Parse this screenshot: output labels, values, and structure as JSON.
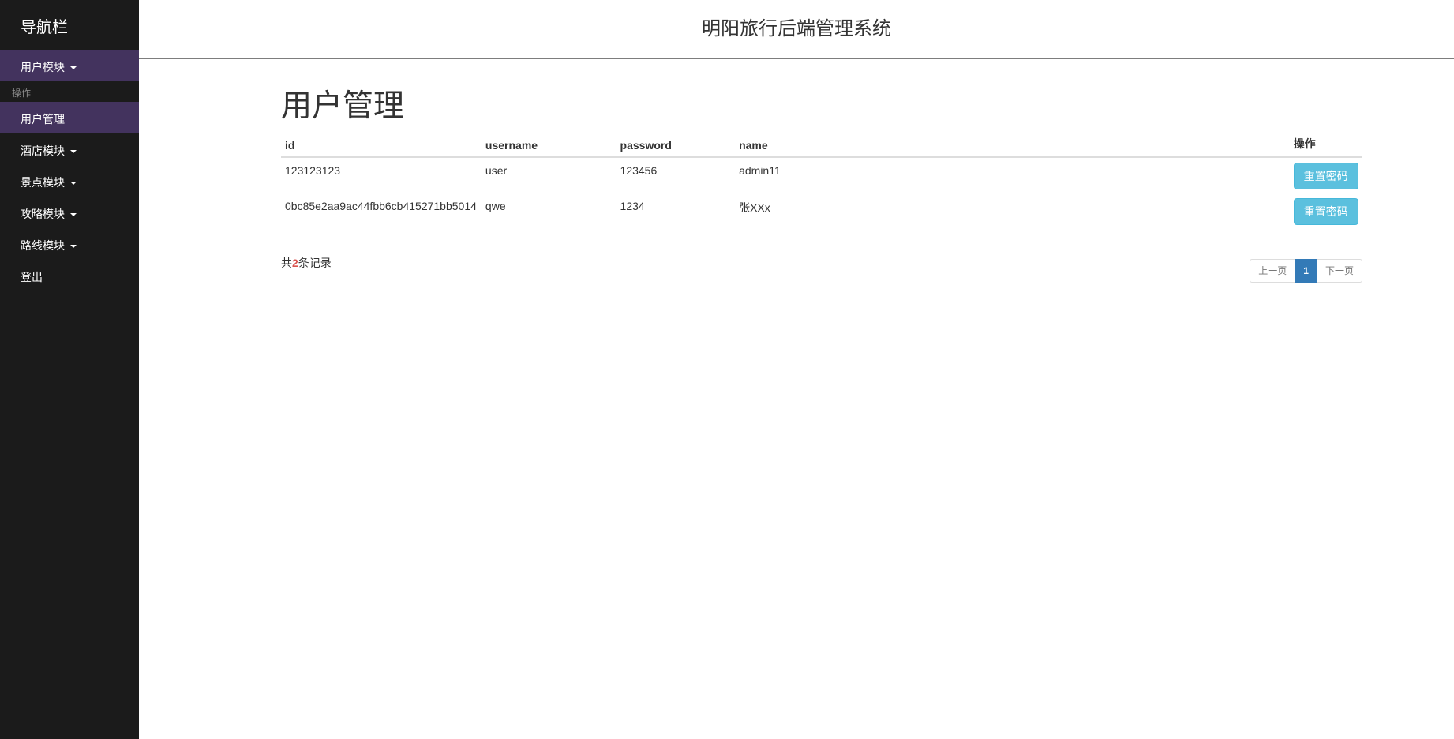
{
  "sidebar": {
    "brand": "导航栏",
    "user_module": "用户模块",
    "section_header": "操作",
    "user_management": "用户管理",
    "hotel_module": "酒店模块",
    "attraction_module": "景点模块",
    "guide_module": "攻略模块",
    "route_module": "路线模块",
    "logout": "登出"
  },
  "header": {
    "title": "明阳旅行后端管理系统"
  },
  "main": {
    "page_title": "用户管理",
    "table": {
      "columns": [
        "id",
        "username",
        "password",
        "name",
        "操作"
      ],
      "rows": [
        {
          "id": "123123123",
          "username": "user",
          "password": "123456",
          "name": "admin11",
          "action": "重置密码"
        },
        {
          "id": "0bc85e2aa9ac44fbb6cb415271bb5014",
          "username": "qwe",
          "password": "1234",
          "name": "张XXx",
          "action": "重置密码"
        }
      ]
    },
    "summary": {
      "prefix": "共",
      "count": "2",
      "suffix": "条记录"
    },
    "pagination": {
      "prev": "上一页",
      "current": "1",
      "next": "下一页"
    }
  },
  "colors": {
    "sidebar_bg": "#1b1b1b",
    "active_bg": "#43335e",
    "button_info": "#5bc0de",
    "page_active": "#337ab7"
  }
}
